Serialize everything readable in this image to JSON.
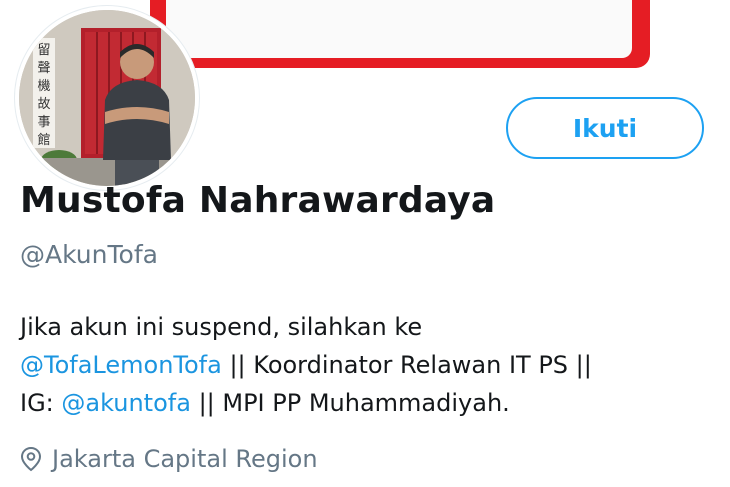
{
  "profile": {
    "name": "Mustofa Nahrawardaya",
    "handle": "@AkunTofa",
    "follow_label": "Ikuti",
    "bio": {
      "line1": "Jika akun ini suspend, silahkan ke",
      "mention1": "@TofaLemonTofa",
      "line2_rest": " || Koordinator Relawan IT PS ||",
      "line3_prefix": "IG: ",
      "mention2": "@akuntofa",
      "line3_rest": " || MPI PP Muhammadiyah."
    },
    "location": "Jakarta Capital Region",
    "avatar_sign": "留聲機故事館"
  },
  "colors": {
    "accent": "#1da1f2",
    "link": "#1b95e0",
    "muted": "#657786",
    "text": "#14171a",
    "banner_red": "#e51d24"
  },
  "icons": {
    "location": "location-pin-icon"
  }
}
